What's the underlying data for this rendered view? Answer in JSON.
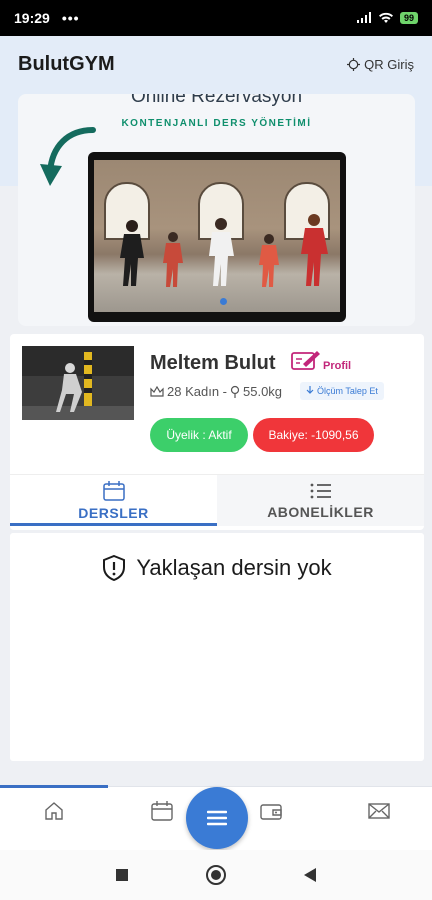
{
  "status_bar": {
    "time": "19:29",
    "dots": "•••",
    "battery": "99"
  },
  "header": {
    "app_title": "BulutGYM",
    "qr_label": "QR Giriş"
  },
  "banner": {
    "heading": "Online Rezervasyon",
    "subheading": "KONTENJANLI DERS YÖNETİMİ"
  },
  "profile": {
    "name": "Meltem Bulut",
    "profile_link": "Profil",
    "age_gender": "28 Kadın -",
    "weight": "55.0kg",
    "measure_request": "Ölçüm Talep Et",
    "membership": "Üyelik : Aktif",
    "balance": "Bakiye: -1090,56"
  },
  "tabs": [
    {
      "label": "DERSLER",
      "active": true,
      "icon": "calendar-icon"
    },
    {
      "label": "ABONELİKLER",
      "active": false,
      "icon": "list-icon"
    }
  ],
  "empty_state": {
    "message": "Yaklaşan dersin yok",
    "icon": "shield-alert-icon"
  },
  "bottom_nav": [
    {
      "name": "home-icon"
    },
    {
      "name": "calendar-icon"
    },
    {
      "name": "menu-icon"
    },
    {
      "name": "wallet-icon"
    },
    {
      "name": "mail-icon"
    }
  ],
  "colors": {
    "accent": "#3a7bd5",
    "active_green": "#3ccf6a",
    "balance_red": "#f0363a",
    "profile_pink": "#c2267a"
  }
}
